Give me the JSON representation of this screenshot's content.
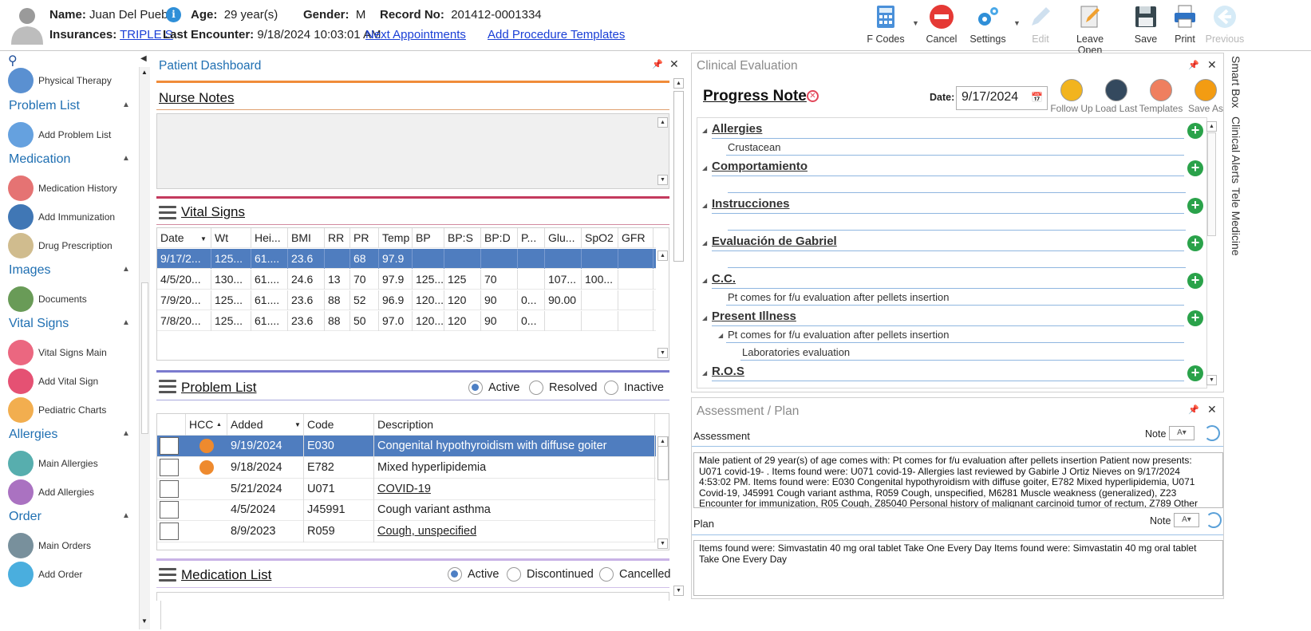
{
  "patient": {
    "name_label": "Name:",
    "name": "Juan Del Pueblo",
    "age_label": "Age:",
    "age": "29 year(s)",
    "gender_label": "Gender:",
    "gender": "M",
    "record_label": "Record No:",
    "record": "201412-0001334",
    "insurances_label": "Insurances:",
    "insurance": "TRIPLE S",
    "last_encounter_label": "Last Encounter:",
    "last_encounter": "9/18/2024 10:03:01 AM",
    "next_appointments": "Next Appointments",
    "add_procedure_templates": "Add Procedure Templates"
  },
  "toolbar": [
    {
      "label": "F Codes",
      "icon": "calculator-icon",
      "enabled": true
    },
    {
      "label": "Cancel",
      "icon": "cancel-icon",
      "enabled": true
    },
    {
      "label": "Settings",
      "icon": "gear-icon",
      "enabled": true
    },
    {
      "label": "Edit",
      "icon": "pencil-icon",
      "enabled": false
    },
    {
      "label": "Leave Open",
      "icon": "leave-open-icon",
      "enabled": true
    },
    {
      "label": "Save",
      "icon": "save-icon",
      "enabled": true
    },
    {
      "label": "Print",
      "icon": "print-icon",
      "enabled": true
    },
    {
      "label": "Previous",
      "icon": "arrow-left-icon",
      "enabled": false
    }
  ],
  "sidebar": {
    "top_item": "Physical Therapy",
    "sections": [
      {
        "title": "Problem List",
        "items": [
          "Add Problem List"
        ]
      },
      {
        "title": "Medication",
        "items": [
          "Medication History",
          "Add Immunization",
          "Drug Prescription"
        ]
      },
      {
        "title": "Images",
        "items": [
          "Documents"
        ]
      },
      {
        "title": "Vital Signs",
        "items": [
          "Vital Signs Main",
          "Add Vital Sign",
          "Pediatric Charts"
        ]
      },
      {
        "title": "Allergies",
        "items": [
          "Main Allergies",
          "Add Allergies"
        ]
      },
      {
        "title": "Order",
        "items": [
          "Main Orders",
          "Add Order"
        ]
      }
    ]
  },
  "dashboard": {
    "title": "Patient Dashboard",
    "nurse_notes": "Nurse Notes",
    "vital_signs": {
      "title": "Vital Signs",
      "columns": [
        "Date",
        "Wt",
        "Hei...",
        "BMI",
        "RR",
        "PR",
        "Temp",
        "BP",
        "BP:S",
        "BP:D",
        "P...",
        "Glu...",
        "SpO2",
        "GFR"
      ],
      "rows": [
        [
          "9/17/2...",
          "125...",
          "61....",
          "23.6",
          "",
          "68",
          "97.9",
          "",
          "",
          "",
          "",
          "",
          "",
          ""
        ],
        [
          "4/5/20...",
          "130...",
          "61....",
          "24.6",
          "13",
          "70",
          "97.9",
          "125...",
          "125",
          "70",
          "",
          "107...",
          "100...",
          ""
        ],
        [
          "7/9/20...",
          "125...",
          "61....",
          "23.6",
          "88",
          "52",
          "96.9",
          "120...",
          "120",
          "90",
          "0...",
          "90.00",
          "",
          ""
        ],
        [
          "7/8/20...",
          "125...",
          "61....",
          "23.6",
          "88",
          "50",
          "97.0",
          "120...",
          "120",
          "90",
          "0...",
          "",
          "",
          ""
        ]
      ]
    },
    "problem_list": {
      "title": "Problem List",
      "filters": [
        {
          "label": "Active",
          "on": true
        },
        {
          "label": "Resolved",
          "on": false
        },
        {
          "label": "Inactive",
          "on": false
        }
      ],
      "columns": [
        "HCC",
        "Added",
        "Code",
        "Description"
      ],
      "rows": [
        {
          "hcc": true,
          "added": "9/19/2024",
          "code": "E030",
          "desc": "Congenital hypothyroidism with diffuse goiter",
          "link": false
        },
        {
          "hcc": true,
          "added": "9/18/2024",
          "code": "E782",
          "desc": "Mixed hyperlipidemia",
          "link": false
        },
        {
          "hcc": false,
          "added": "5/21/2024",
          "code": "U071",
          "desc": "COVID-19",
          "link": true
        },
        {
          "hcc": false,
          "added": "4/5/2024",
          "code": "J45991",
          "desc": "Cough variant asthma",
          "link": false
        },
        {
          "hcc": false,
          "added": "8/9/2023",
          "code": "R059",
          "desc": "Cough, unspecified",
          "link": true
        }
      ]
    },
    "medication_list": {
      "title": "Medication List",
      "filters": [
        {
          "label": "Active",
          "on": true
        },
        {
          "label": "Discontinued",
          "on": false
        },
        {
          "label": "Cancelled",
          "on": false
        }
      ]
    }
  },
  "clinical": {
    "title": "Clinical Evaluation",
    "note_title": "Progress Note",
    "date_label": "Date:",
    "date": "9/17/2024",
    "tools": [
      "Follow Up",
      "Load Last",
      "Templates",
      "Save As"
    ],
    "sections": [
      {
        "title": "Allergies",
        "lines": [
          "Crustacean"
        ]
      },
      {
        "title": "Comportamiento",
        "lines": []
      },
      {
        "title": "Instrucciones",
        "lines": []
      },
      {
        "title": "Evaluación de Gabriel",
        "lines": []
      },
      {
        "title": "C.C.",
        "lines": [
          "Pt comes for f/u evaluation after pellets insertion"
        ]
      },
      {
        "title": "Present Illness",
        "lines": [
          "Pt comes for f/u evaluation after pellets insertion",
          "Laboratories evaluation"
        ]
      },
      {
        "title": "R.O.S",
        "lines": []
      }
    ]
  },
  "assessment": {
    "title": "Assessment / Plan",
    "assessment_label": "Assessment",
    "note_label": "Note",
    "assessment_text": "Male patient of 29 year(s) of age comes with:  Pt comes for f/u evaluation after pellets insertion  Patient now presents: U071 covid-19- . Items found were:  U071 covid-19-    Allergies last reviewed by Gabirle J Ortiz Nieves on 9/17/2024 4:53:02 PM.    Items found were:  E030 Congenital hypothyroidism with diffuse goiter, E782 Mixed hyperlipidemia, U071 Covid-19, J45991 Cough variant asthma, R059 Cough, unspecified, M6281 Muscle weakness (generalized), Z23 Encounter for immunization, R05 Cough, Z85040 Personal history of malignant carcinoid tumor of rectum, Z789 Other",
    "plan_label": "Plan",
    "plan_text": "  Items found were:  Simvastatin 40 mg oral tablet Take One Every Day   Items found were:  Simvastatin 40 mg oral tablet Take One Every Day"
  },
  "side_tabs": [
    "Smart Box",
    "Clinical Alerts",
    "Tele Medicine"
  ]
}
